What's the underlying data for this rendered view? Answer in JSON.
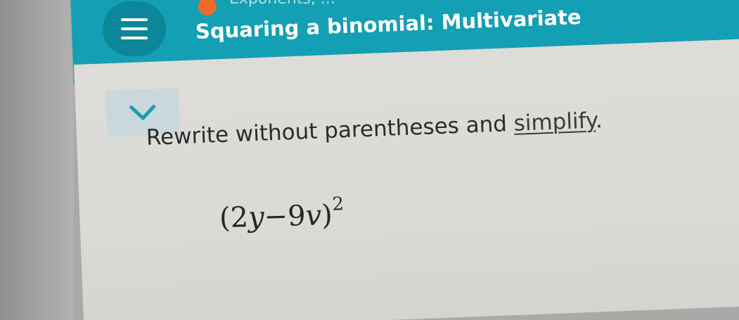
{
  "header": {
    "breadcrumb": "Exponents, ...",
    "title": "Squaring a binomial: Multivariate",
    "menu_icon": "hamburger-menu-icon",
    "status_dot_color": "#f26a2a"
  },
  "problem": {
    "instruction_prefix": "Rewrite without parentheses and ",
    "instruction_link": "simplify",
    "instruction_suffix": ".",
    "expression": {
      "open_paren": "(",
      "coef1": "2",
      "var1": "y",
      "operator": "−",
      "coef2": "9",
      "var2": "v",
      "close_paren": ")",
      "exponent": "2"
    }
  },
  "colors": {
    "header": "#139fb4",
    "menu_button": "#0b8799",
    "content_bg": "#dcdad6"
  }
}
